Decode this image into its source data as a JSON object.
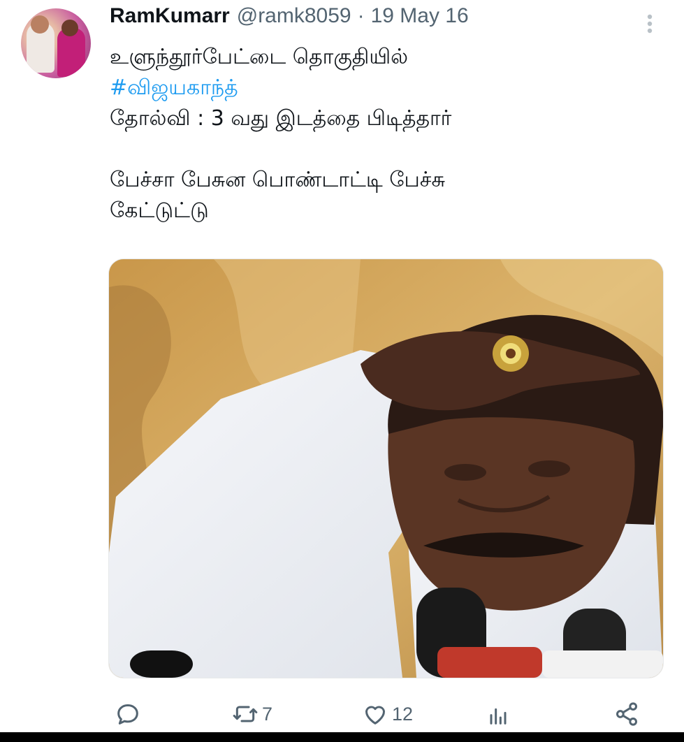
{
  "tweet": {
    "author": {
      "display_name": "RamKumarr",
      "handle": "@ramk8059",
      "separator": "·",
      "date": "19 May 16"
    },
    "more_icon": "more-vertical-icon",
    "text": {
      "line1": "உளுந்தூர்பேட்டை தொகுதியில்",
      "hashtag": "#விஜயகாந்த்",
      "line3": "தோல்வி : 3 வது இடத்தை பிடித்தார்",
      "line4": "பேச்சா பேசுன பொண்டாட்டி பேச்சு",
      "line5": "கேட்டுட்டு"
    },
    "actions": {
      "reply": {
        "icon": "reply-icon"
      },
      "retweet": {
        "icon": "retweet-icon",
        "count": "7"
      },
      "like": {
        "icon": "heart-icon",
        "count": "12"
      },
      "views": {
        "icon": "views-icon"
      },
      "share": {
        "icon": "share-icon"
      }
    },
    "colors": {
      "text": "#0f1419",
      "secondary": "#536471",
      "hashtag": "#1d9bf0"
    }
  }
}
